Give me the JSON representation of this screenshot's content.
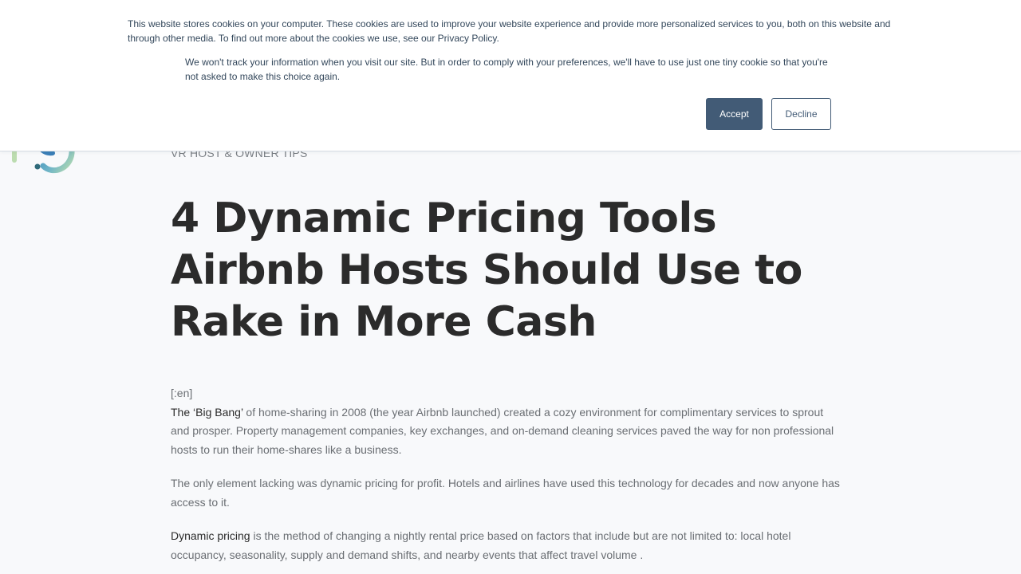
{
  "cookie_banner": {
    "text": "This website stores cookies on your computer. These cookies are used to improve your website experience and provide more personalized services to you, both on this website and through other media. To find out more about the cookies we use, see our Privacy Policy.",
    "subtext": "We won't track your information when you visit our site. But in order to comply with your preferences, we'll have to use just one tiny cookie so that you're not asked to make this choice again.",
    "accept_label": "Accept",
    "decline_label": "Decline"
  },
  "article": {
    "category": "VR HOST & OWNER TIPS",
    "title": "4 Dynamic Pricing Tools Airbnb Hosts Should Use to Rake in More Cash",
    "lang_tag": "[:en]",
    "paragraphs": [
      {
        "lead": "The ‘Big Bang’",
        "text": " of home-sharing in 2008 (the year Airbnb launched) created a cozy environment for complimentary services to sprout and prosper. Property management companies, key exchanges, and on-demand cleaning services paved the way for non professional hosts to run their home-shares like a business."
      },
      {
        "lead": "",
        "text": "The only element lacking was dynamic pricing for profit. Hotels and airlines have used this technology for decades and now anyone has access to it."
      },
      {
        "lead": "Dynamic pricing",
        "text": " is the method of changing a nightly rental price based on factors that include but are not limited to: local hotel occupancy, seasonality, supply and demand shifts, and nearby events that affect travel volume ."
      }
    ]
  },
  "colors": {
    "accent": "#425b76",
    "title": "#2b2b2b",
    "body_text": "#6a6e73",
    "background": "#f8f9fb"
  },
  "icons": {
    "logo": "site-logo-icon"
  }
}
